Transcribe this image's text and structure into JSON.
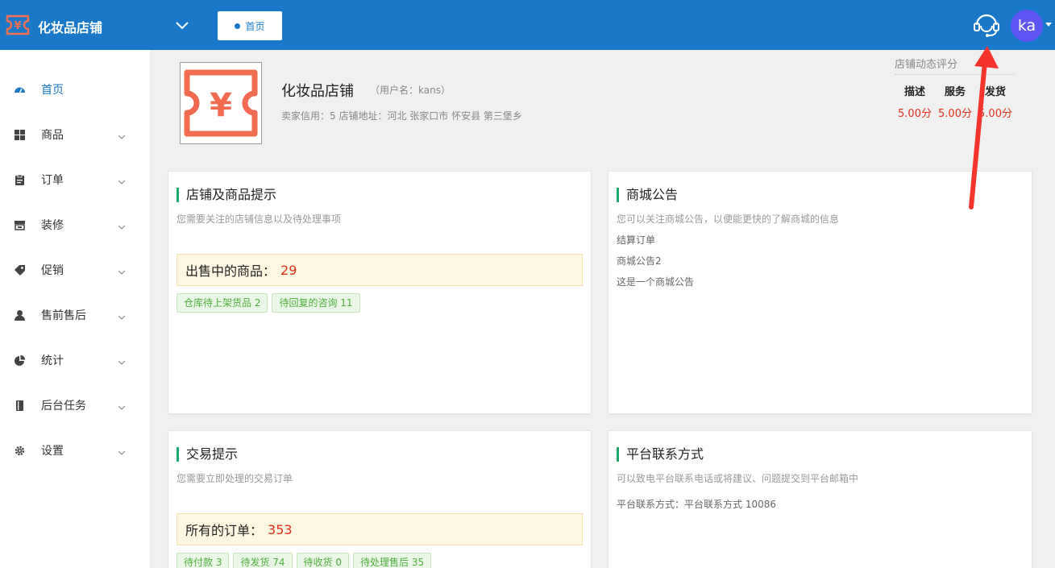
{
  "header": {
    "app_title": "化妆品店铺",
    "tab_home": "首页",
    "avatar_text": "ka",
    "accent_color": "#1a78c9"
  },
  "sidebar": {
    "items": [
      {
        "label": "首页",
        "icon": "dashboard-icon"
      },
      {
        "label": "商品",
        "icon": "grid-icon"
      },
      {
        "label": "订单",
        "icon": "clipboard-icon"
      },
      {
        "label": "装修",
        "icon": "store-icon"
      },
      {
        "label": "促销",
        "icon": "tag-icon"
      },
      {
        "label": "售前售后",
        "icon": "user-icon"
      },
      {
        "label": "统计",
        "icon": "pie-chart-icon"
      },
      {
        "label": "后台任务",
        "icon": "book-icon"
      },
      {
        "label": "设置",
        "icon": "gear-icon"
      }
    ]
  },
  "shop": {
    "name": "化妆品店铺",
    "username": "（用户名：kans）",
    "info": "卖家信用：5  店铺地址：河北 张家口市 怀安县 第三堡乡"
  },
  "rating": {
    "title": "店铺动态评分",
    "cols": [
      {
        "label": "描述",
        "value": "5.00分"
      },
      {
        "label": "服务",
        "value": "5.00分"
      },
      {
        "label": "发货",
        "value": "5.00分"
      }
    ]
  },
  "card_shop": {
    "title": "店铺及商品提示",
    "sub": "您需要关注的店铺信息以及待处理事项",
    "stat_label": "出售中的商品：",
    "stat_value": "29",
    "tags": [
      "仓库待上架货品 2",
      "待回复的咨询 11"
    ]
  },
  "card_notice": {
    "title": "商城公告",
    "sub": "您可以关注商城公告，以便能更快的了解商城的信息",
    "items": [
      "结算订单",
      "商城公告2",
      "这是一个商城公告"
    ]
  },
  "card_trade": {
    "title": "交易提示",
    "sub": "您需要立即处理的交易订单",
    "stat_label": "所有的订单：",
    "stat_value": "353",
    "tags": [
      "待付款 3",
      "待发货 74",
      "待收货 0",
      "待处理售后 35"
    ]
  },
  "card_contact": {
    "title": "平台联系方式",
    "sub": "可以致电平台联系电话或将建议、问题提交到平台邮箱中",
    "line": "平台联系方式：平台联系方式  10086"
  }
}
